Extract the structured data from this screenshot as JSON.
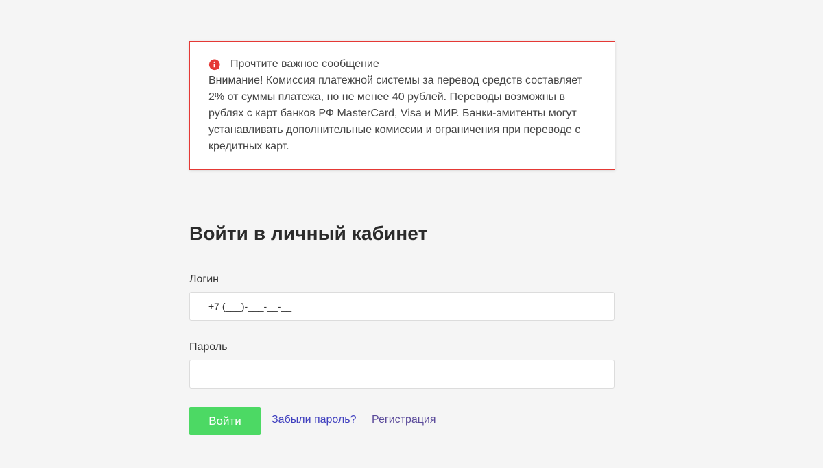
{
  "notice": {
    "icon": "alert-info-icon",
    "title": "Прочтите важное сообщение",
    "text": "Внимание! Комиссия платежной системы за перевод средств составляет 2% от суммы платежа, но не менее 40 рублей. Переводы возможны в рублях с карт банков РФ MasterCard, Visa и МИР. Банки-эмитенты могут устанавливать дополнительные комиссии и ограничения при переводе с кредитных карт.",
    "border_color": "#e53935",
    "icon_color": "#e53935"
  },
  "login_form": {
    "title": "Войти в личный кабинет",
    "login_label": "Логин",
    "login_value": "+7 (___)-___-__-__",
    "password_label": "Пароль",
    "password_value": "",
    "submit_label": "Войти",
    "submit_color": "#4cd964",
    "forgot_link": "Забыли пароль?",
    "forgot_color": "#3f3fbf",
    "register_link": "Регистрация",
    "register_color": "#5a4a9a"
  }
}
